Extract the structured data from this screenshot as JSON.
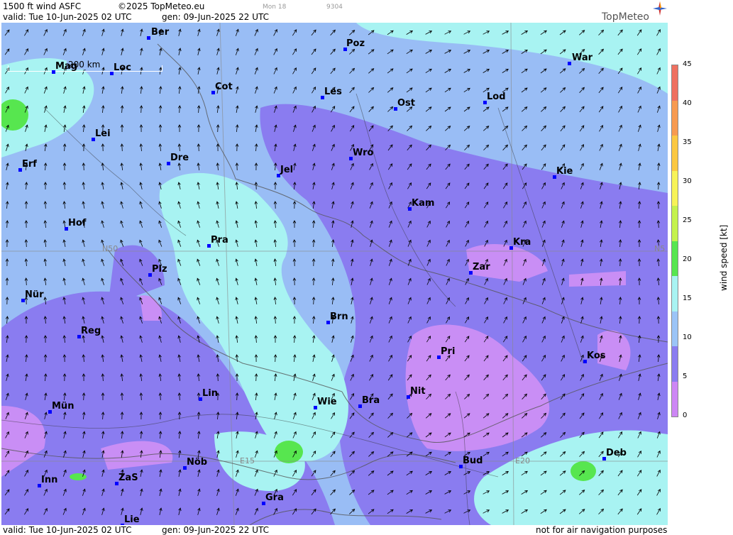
{
  "header": {
    "product": "1500 ft wind ASFC",
    "copyright": "©2025 TopMeteo.eu",
    "small1": "Mon 18",
    "small2": "9304",
    "valid": "valid:  Tue  10-Jun-2025  02 UTC",
    "gen": "gen:  09-Jun-2025 22 UTC",
    "logo": "TopMeteo"
  },
  "footer": {
    "valid": "valid:  Tue  10-Jun-2025  02 UTC",
    "gen": "gen:  09-Jun-2025 22 UTC",
    "note": "not for air navigation purposes"
  },
  "scale_bar": {
    "label": "200 km"
  },
  "grid_labels": {
    "n50": "N50",
    "n50_right": "N5",
    "e15": "E15",
    "e20": "E20"
  },
  "legend": {
    "unit": "wind  speed  [kt]",
    "ticks": [
      "45",
      "40",
      "35",
      "30",
      "25",
      "20",
      "15",
      "10",
      "5",
      "0"
    ],
    "colors": [
      "#ef7060",
      "#f79a50",
      "#fbc842",
      "#f7f358",
      "#c4f24d",
      "#57e64f",
      "#a8f3f2",
      "#9bc4f7",
      "#8a7cf0",
      "#cd86f5"
    ]
  },
  "cities": [
    {
      "name": "Ber"
    },
    {
      "name": "Poz"
    },
    {
      "name": "War"
    },
    {
      "name": "Mag"
    },
    {
      "name": "Loc"
    },
    {
      "name": "Cot"
    },
    {
      "name": "Les"
    },
    {
      "name": "Ost"
    },
    {
      "name": "Lod"
    },
    {
      "name": "Lei"
    },
    {
      "name": "Erf"
    },
    {
      "name": "Dre"
    },
    {
      "name": "Jel"
    },
    {
      "name": "Wro"
    },
    {
      "name": "Kie"
    },
    {
      "name": "Kam"
    },
    {
      "name": "Hof"
    },
    {
      "name": "Pra"
    },
    {
      "name": "Kra"
    },
    {
      "name": "Zar"
    },
    {
      "name": "Plz"
    },
    {
      "name": "Nür"
    },
    {
      "name": "Brn"
    },
    {
      "name": "Reg"
    },
    {
      "name": "Pri"
    },
    {
      "name": "Kos"
    },
    {
      "name": "Lin"
    },
    {
      "name": "Nit"
    },
    {
      "name": "Mün"
    },
    {
      "name": "Wie"
    },
    {
      "name": "Bra"
    },
    {
      "name": "Deb"
    },
    {
      "name": "Nöb"
    },
    {
      "name": "Bud"
    },
    {
      "name": "Inn"
    },
    {
      "name": "ZaS"
    },
    {
      "name": "Gra"
    },
    {
      "name": "Lie"
    }
  ]
}
